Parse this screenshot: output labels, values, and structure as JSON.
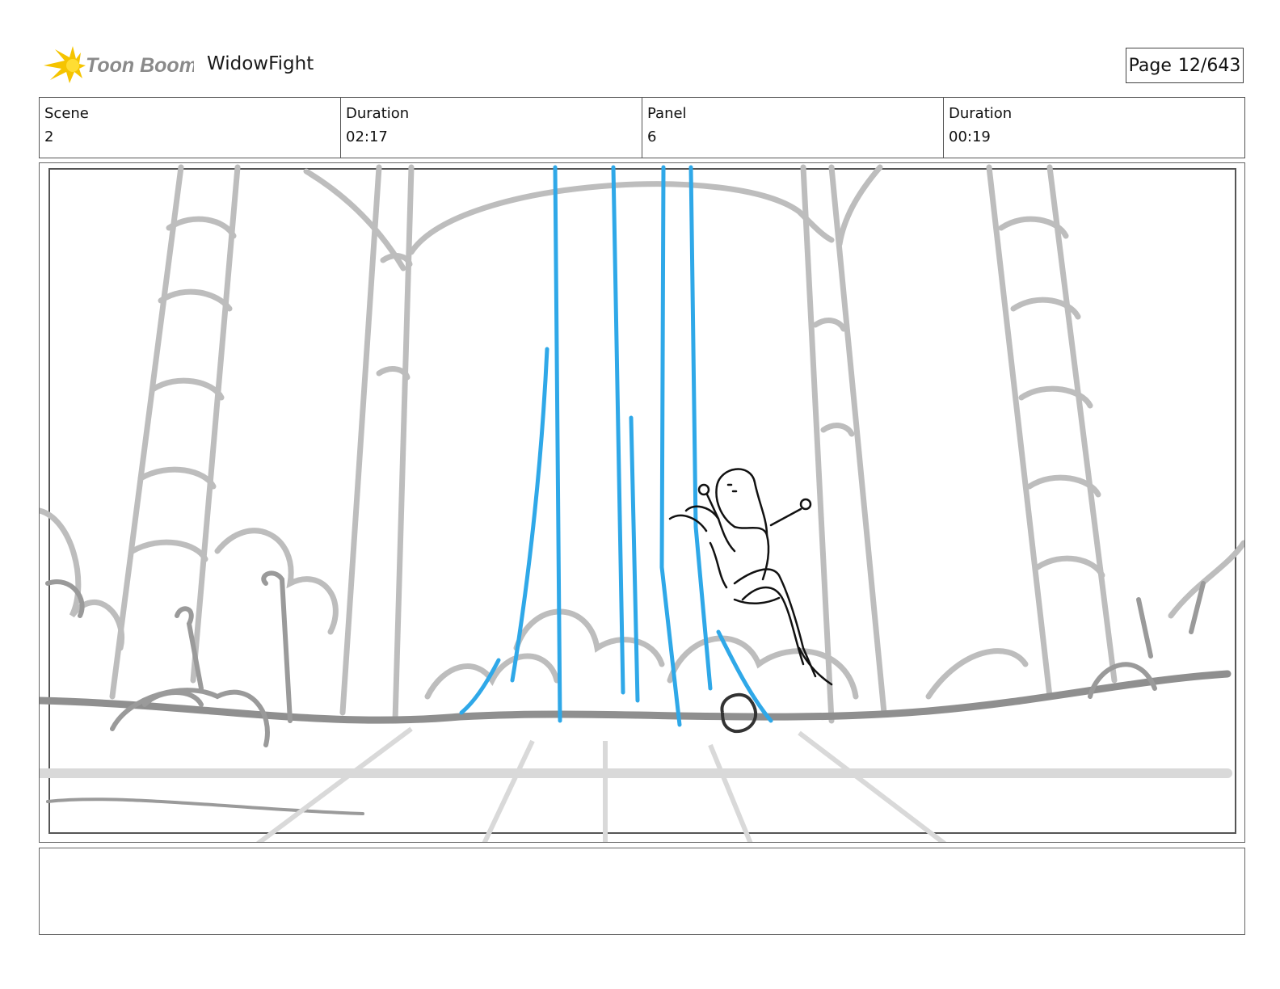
{
  "header": {
    "logo_text": "Toon Boom",
    "project_title": "WidowFight",
    "page_label": "Page",
    "page_number": "12/643"
  },
  "info": {
    "scene_label": "Scene",
    "scene_value": "2",
    "scene_duration_label": "Duration",
    "scene_duration_value": "02:17",
    "panel_label": "Panel",
    "panel_value": "6",
    "panel_duration_label": "Duration",
    "panel_duration_value": "00:19"
  },
  "notes": {
    "text": ""
  },
  "colors": {
    "sketch_gray": "#b8b8b8",
    "ground_gray": "#8a8a8a",
    "water_blue": "#2fa8e8",
    "character_ink": "#111111",
    "logo_yellow": "#f5c400"
  }
}
